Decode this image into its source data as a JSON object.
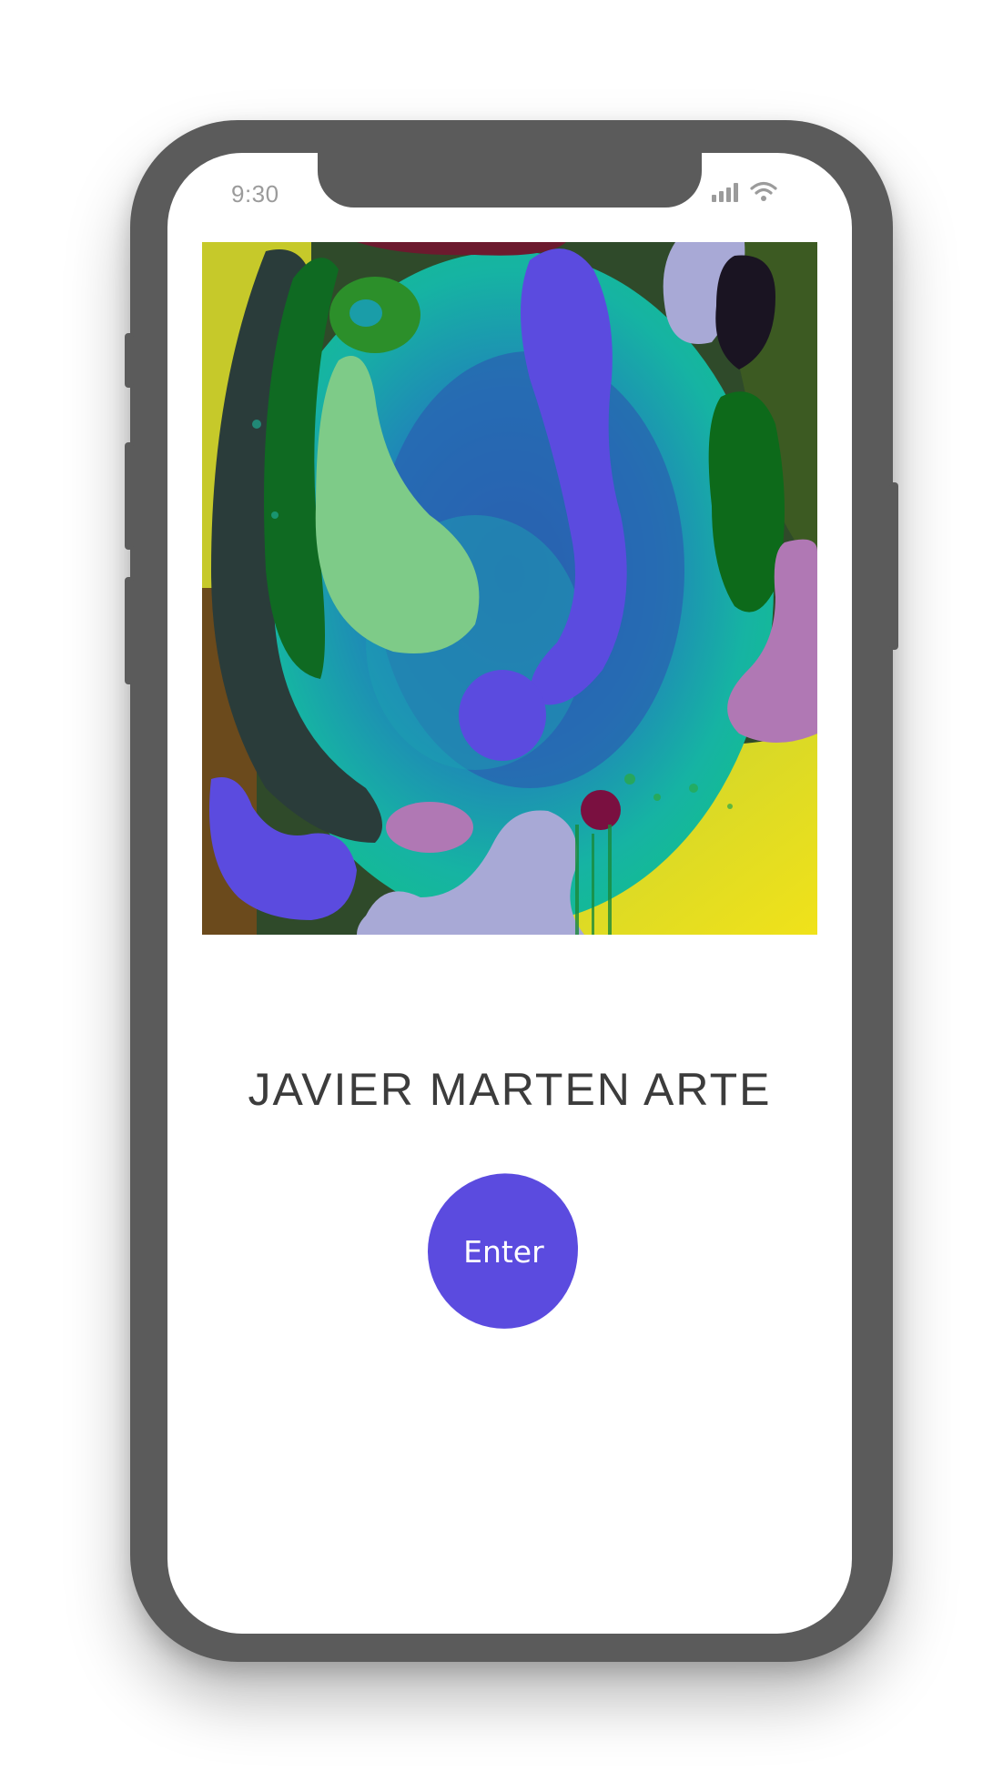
{
  "status_bar": {
    "time": "9:30",
    "icons": [
      "signal-icon",
      "wifi-icon"
    ]
  },
  "hero": {
    "image": "abstract-painting-image"
  },
  "site": {
    "title": "JAVIER MARTEN ARTE"
  },
  "actions": {
    "enter_label": "Enter"
  },
  "colors": {
    "frame": "#5b5b5b",
    "accent": "#5b4bdf",
    "status_text": "#9b9b9b",
    "title_text": "#3c3c3c"
  }
}
